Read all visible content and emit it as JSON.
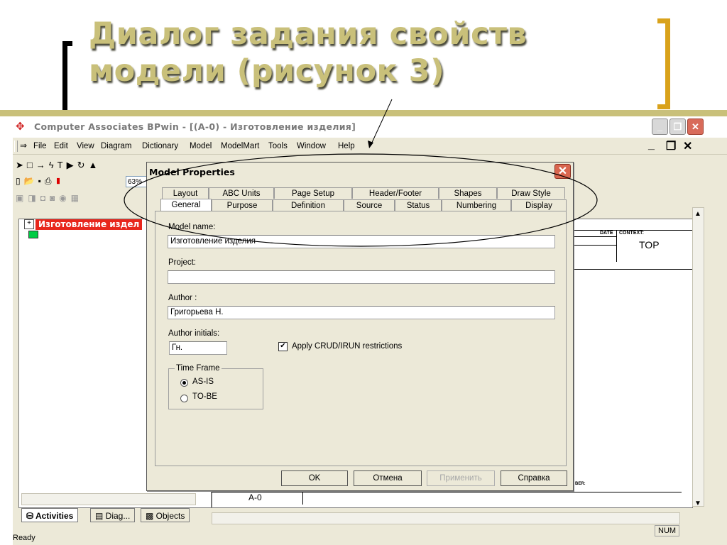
{
  "slide": {
    "title_line1": "Диалог задания свойств",
    "title_line2": "модели (рисунок 3)"
  },
  "app": {
    "title": "Computer Associates BPwin - [(A-0)  - Изготовление изделия]",
    "menu": [
      "File",
      "Edit",
      "View",
      "Diagram",
      "Dictionary",
      "Model",
      "ModelMart",
      "Tools",
      "Window",
      "Help"
    ],
    "zoom": "63%",
    "tree_root_label": "Изготовление издел",
    "bottom_tabs": [
      "Activities",
      "Diag...",
      "Objects"
    ],
    "frame": {
      "date_label": "DATE",
      "context_label": "CONTEXT:",
      "context_value": "TOP",
      "number_label": "BER:",
      "node_label": "A-0"
    },
    "status": {
      "ready": "Ready",
      "num": "NUM"
    }
  },
  "dialog": {
    "title": "Model Properties",
    "tabs_back": [
      "Layout",
      "ABC Units",
      "Page Setup",
      "Header/Footer",
      "Shapes",
      "Draw Style"
    ],
    "tabs_front": [
      "General",
      "Purpose",
      "Definition",
      "Source",
      "Status",
      "Numbering",
      "Display"
    ],
    "active_tab": "General",
    "model_name_label": "Model name:",
    "model_name_value": "Изготовление изделия",
    "project_label": "Project:",
    "project_value": "",
    "author_label": "Author :",
    "author_value": "Григорьева Н.",
    "initials_label": "Author initials:",
    "initials_value": "Гн.",
    "crud_label": "Apply CRUD/IRUN restrictions",
    "crud_checked": true,
    "time_frame_label": "Time Frame",
    "as_is_label": "AS-IS",
    "to_be_label": "TO-BE",
    "time_frame_value": "AS-IS",
    "buttons": {
      "ok": "OK",
      "cancel": "Отмена",
      "apply": "Применить",
      "help": "Справка"
    }
  }
}
